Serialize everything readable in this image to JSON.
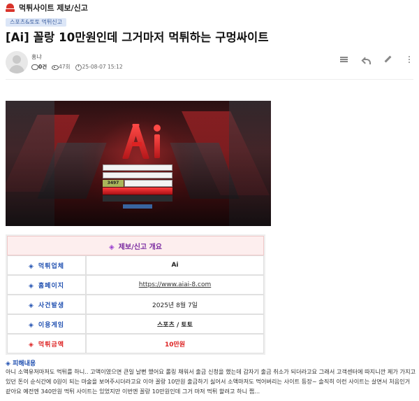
{
  "board": {
    "title": "먹튀사이트 제보/신고"
  },
  "category": "스포츠&토토 먹튀신고",
  "post": {
    "title": "[Ai] 꼴랑 10만원인데 그거마저 먹튀하는 구멍싸이트",
    "author": "홍냐",
    "comments": "0건",
    "views": "47회",
    "date": "25-08-07 15:12"
  },
  "toolbar": {
    "icons": [
      "list-icon",
      "reply-icon",
      "edit-icon",
      "more-icon"
    ]
  },
  "site_screenshot": {
    "captcha": "3497"
  },
  "report_table": {
    "header": "제보/신고 개요",
    "rows": [
      {
        "label": "먹튀업체",
        "value": "Ai",
        "style": "bold"
      },
      {
        "label": "홈페이지",
        "value": "https://www.aiai-8.com",
        "style": "link"
      },
      {
        "label": "사건발생",
        "value": "2025년 8월 7일",
        "style": "normal"
      },
      {
        "label": "이용게임",
        "value": "스포츠 / 토토",
        "style": "bold"
      },
      {
        "label": "먹튀금액",
        "value": "10만원",
        "style": "red"
      }
    ]
  },
  "damage": {
    "title": "피해내용",
    "text": "아니 소액유저마저도 먹튀를 하니..  고액이였으면 큰일 날뻔 했어요 롤링 채워서 출금 신청을 했는데 갑자기 출금 취소가 되더라고요 그래서 고객센터에 따지니깐 제가 가지고 있던 돈이 순식간에 0원이 되는 마술을 보여주시더라고요 이야 꼴랑 10만원 출금하기 싫어서 소액마저도 먹어버리는 사이트 등장~ 솔직히 이런 사이트는 살면서 처음인거 같아요 예전엔 340만원 먹튀 사이트는 있었지만 이번엔 꼴랑 10만원인데 그거 마저 먹튀 할려고 하니 쩝..."
  },
  "colors": {
    "accent_blue": "#1f4fb0",
    "accent_red": "#d22222",
    "header_bg": "#fdeeee",
    "header_text": "#7a2aa0",
    "badge_bg": "#dce6f7"
  }
}
